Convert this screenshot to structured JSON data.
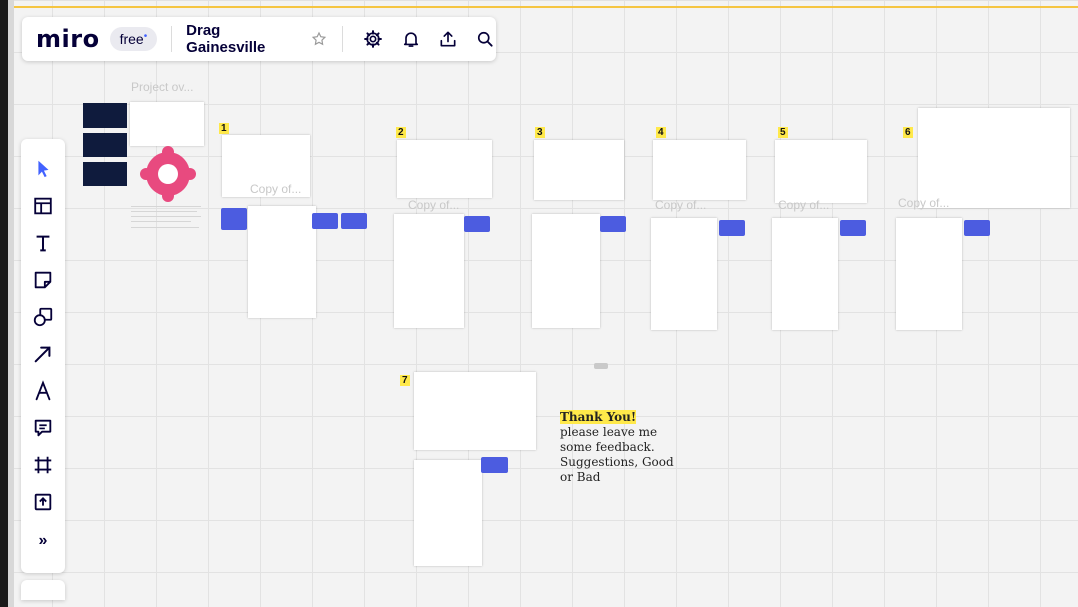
{
  "app": {
    "logo": "miro",
    "plan": "free",
    "plan_mark": "•",
    "board_name": "Drag Gainesville"
  },
  "topbar_icons": [
    "star-icon",
    "settings-icon",
    "bell-icon",
    "upload-icon",
    "search-icon"
  ],
  "tools": [
    "select-tool-icon",
    "templates-icon",
    "text-icon",
    "sticky-note-icon",
    "shapes-icon",
    "arrow-icon",
    "pen-icon",
    "comment-icon",
    "frame-icon",
    "upload-icon",
    "more-tools-icon"
  ],
  "more_tools_glyph": "»",
  "frames": {
    "overview_label": "Project ov...",
    "copy_label": "Copy of...",
    "numbers": [
      "1",
      "2",
      "3",
      "4",
      "5",
      "6",
      "7"
    ]
  },
  "thank_you": {
    "title": "Thank You!",
    "body": "please leave me some feedback. Suggestions, Good or Bad"
  },
  "colors": {
    "accent": "#4262ff",
    "topline": "#f5c542",
    "highlight": "#ffe94a",
    "navy": "#0f1b3d"
  }
}
